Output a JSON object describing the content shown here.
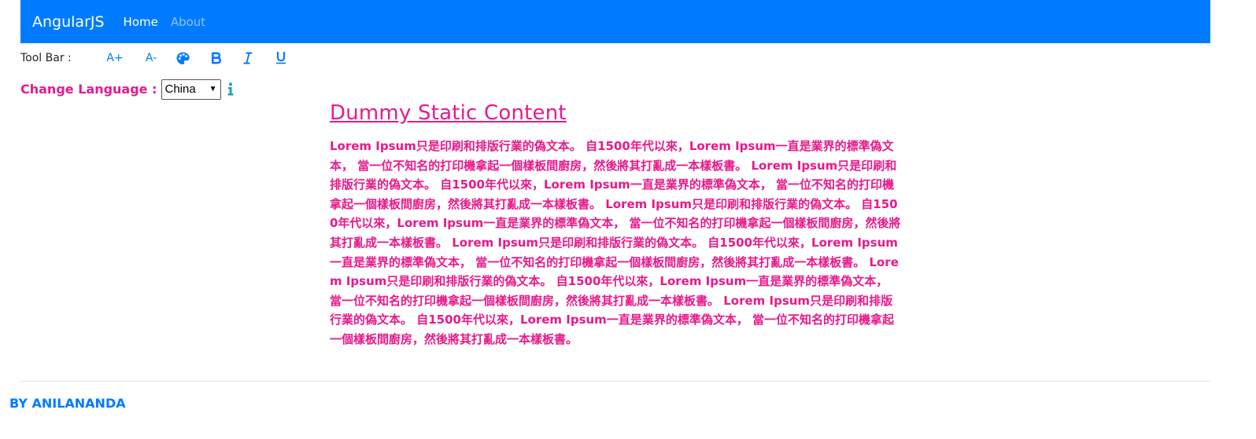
{
  "navbar": {
    "brand": "AngularJS",
    "links": [
      {
        "label": "Home",
        "active": true
      },
      {
        "label": "About",
        "active": false
      }
    ],
    "background": "#007bff"
  },
  "toolbar": {
    "label": "Tool Bar :",
    "buttons": [
      {
        "name": "increase-font",
        "label": "A+"
      },
      {
        "name": "decrease-font",
        "label": "A-"
      },
      {
        "name": "color-palette",
        "icon": "palette-icon"
      },
      {
        "name": "bold",
        "icon": "bold-icon"
      },
      {
        "name": "italic",
        "icon": "italic-icon"
      },
      {
        "name": "underline",
        "icon": "underline-icon"
      }
    ]
  },
  "language": {
    "label": "Change Language :",
    "selected": "China",
    "info_icon": "info-icon"
  },
  "content": {
    "title": "Dummy Static Content",
    "body": "Lorem Ipsum只是印刷和排版行業的偽文本。 自1500年代以來，Lorem Ipsum一直是業界的標準偽文本， 當一位不知名的打印機拿起一個樣板間廚房，然後將其打亂成一本樣板書。 Lorem Ipsum只是印刷和排版行業的偽文本。 自1500年代以來，Lorem Ipsum一直是業界的標準偽文本， 當一位不知名的打印機拿起一個樣板間廚房，然後將其打亂成一本樣板書。 Lorem Ipsum只是印刷和排版行業的偽文本。 自1500年代以來，Lorem Ipsum一直是業界的標準偽文本， 當一位不知名的打印機拿起一個樣板間廚房，然後將其打亂成一本樣板書。 Lorem Ipsum只是印刷和排版行業的偽文本。 自1500年代以來，Lorem Ipsum一直是業界的標準偽文本， 當一位不知名的打印機拿起一個樣板間廚房，然後將其打亂成一本樣板書。 Lorem Ipsum只是印刷和排版行業的偽文本。 自1500年代以來，Lorem Ipsum一直是業界的標準偽文本， 當一位不知名的打印機拿起一個樣板間廚房，然後將其打亂成一本樣板書。 Lorem Ipsum只是印刷和排版行業的偽文本。 自1500年代以來，Lorem Ipsum一直是業界的標準偽文本， 當一位不知名的打印機拿起一個樣板間廚房，然後將其打亂成一本樣板書。",
    "color": "#e8198b"
  },
  "footer": {
    "text": "BY ANILANANDA",
    "color": "#007bff"
  }
}
